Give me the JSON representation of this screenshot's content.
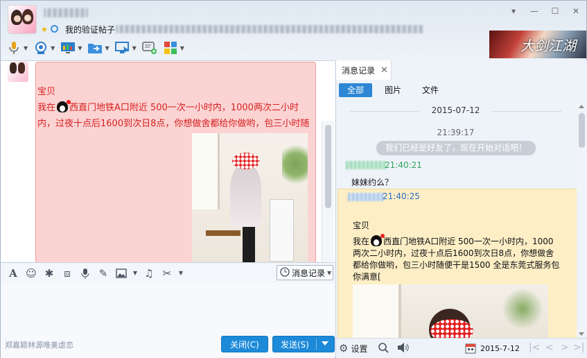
{
  "header": {
    "signature": "我的验证帖子",
    "banner_text": "大剑江湖",
    "controls": [
      "▾",
      "—",
      "☐",
      "✕"
    ]
  },
  "toolbar": {
    "buttons": [
      "mic-icon",
      "camera-icon",
      "screen-share-icon",
      "file-transfer-icon",
      "remote-desktop-icon",
      "message-add-icon",
      "apps-icon"
    ]
  },
  "chat": {
    "sender_name": "宝贝",
    "message_prefix": "我在",
    "message_body": "西直门地铁A口附近 500一次一小时内，1000两次二小时内，过夜十点后1600到次日8点，你想做舍都给你做哟，包三小时随"
  },
  "editor_toolbar": {
    "items": [
      "font-icon",
      "emoji-icon",
      "shake-icon",
      "screenshot-icon",
      "voice-icon",
      "edit-icon",
      "image-icon",
      "music-icon",
      "scissors-icon"
    ],
    "history_label": "消息记录"
  },
  "footer": {
    "ad_text": "郑嘉颖林源唯美虐恋",
    "close_label": "关闭(C)",
    "send_label": "发送(S)"
  },
  "history": {
    "tab_label": "消息记录",
    "filters": [
      "全部",
      "图片",
      "文件"
    ],
    "date": "2015-07-12",
    "time1": "21:39:17",
    "system_msg": "我们已经是好友了，现在开始对话吧！",
    "msg1_time": "21:40:21",
    "msg1_text": "妹妹约么？",
    "msg2_time": "21:40:25",
    "msg2_name": "宝贝",
    "msg2_prefix": "我在",
    "msg2_text": "西直门地铁A口附近 500一次一小时内，1000两次二小时内，过夜十点后1600到次日8点，你想做舍都给你做哟，包三小时随便干是1500 全是东莞式服务包你满意[",
    "settings_label": "设置",
    "footer_date": "2015-7-12"
  },
  "colors": {
    "accent": "#2d87d4",
    "bubble_bg": "#fcd3d3",
    "bubble_text": "#d62020",
    "history_msg_bg": "#fdeec6"
  }
}
